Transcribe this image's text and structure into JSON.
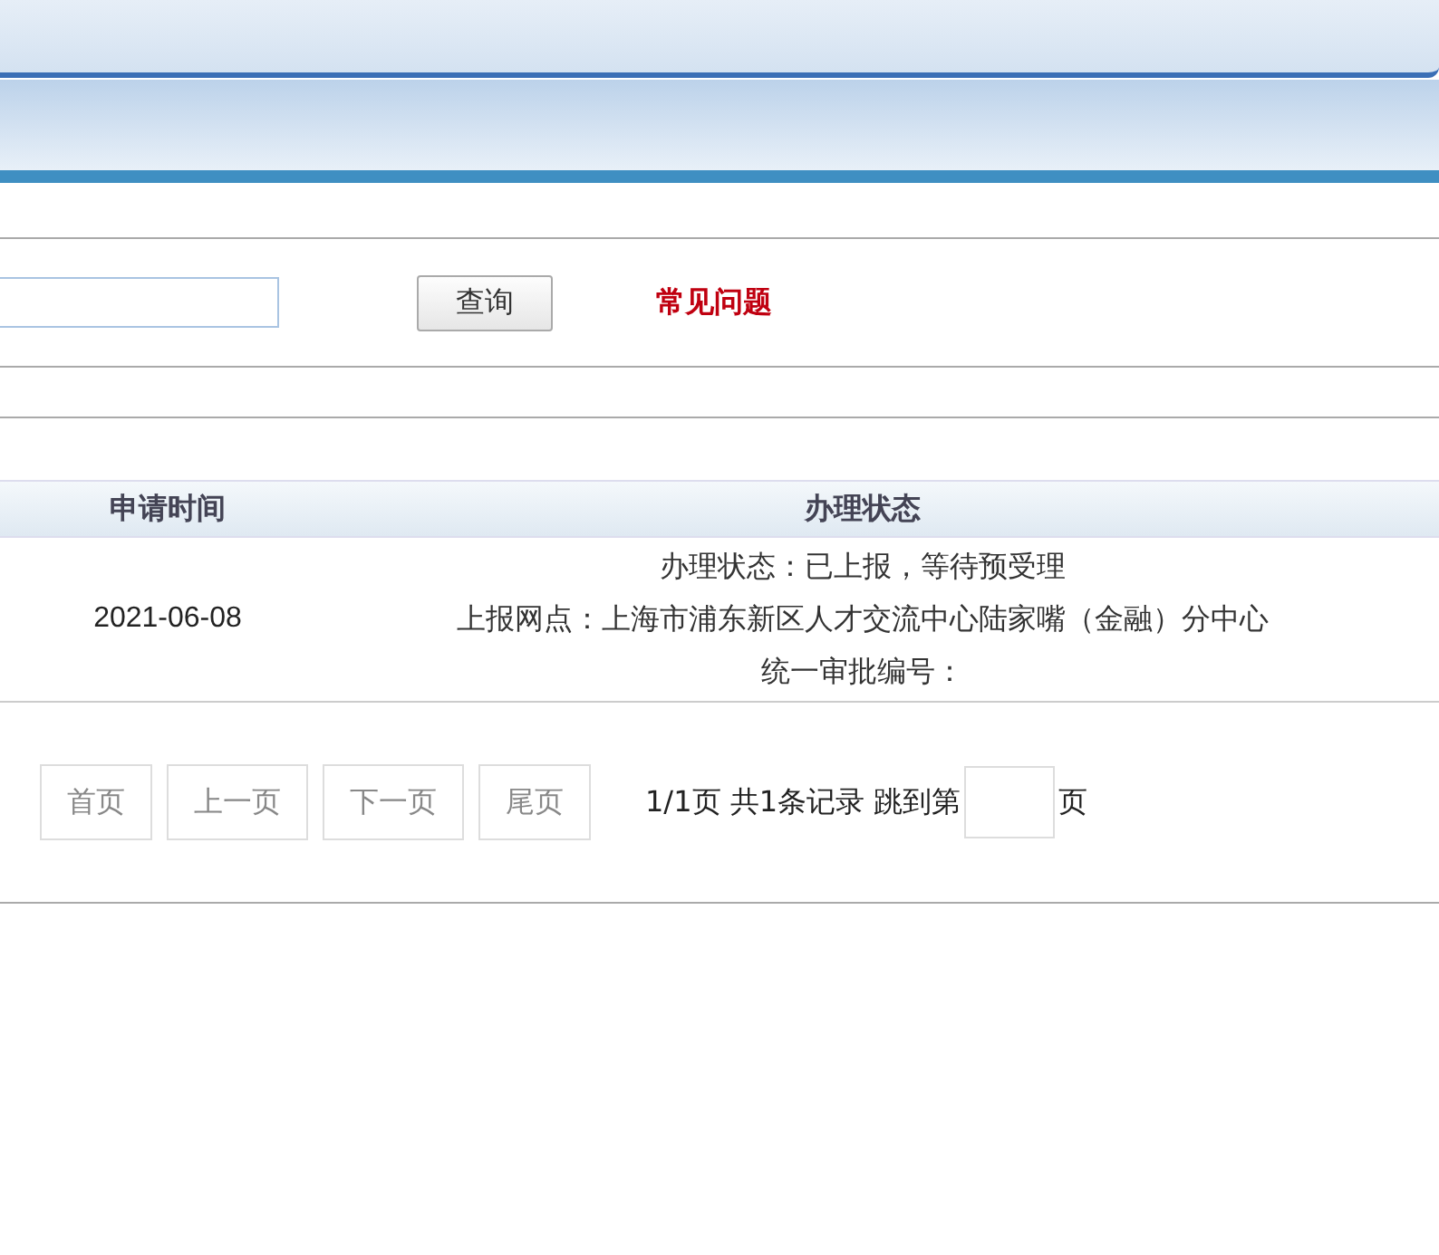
{
  "search": {
    "button": "查询",
    "link": "常见问题"
  },
  "table": {
    "columns": [
      "申请时间",
      "办理状态"
    ],
    "rows": [
      {
        "date": "2021-06-08",
        "status_lines": [
          "办理状态：已上报，等待预受理",
          "上报网点：上海市浦东新区人才交流中心陆家嘴（金融）分中心",
          "统一审批编号："
        ]
      }
    ]
  },
  "pagination": {
    "buttons": [
      {
        "label": "首页",
        "disabled": true
      },
      {
        "label": "上一页",
        "disabled": true
      },
      {
        "label": "下一页",
        "disabled": true
      },
      {
        "label": "尾页",
        "disabled": true
      }
    ],
    "summary": "1/1页 共1条记录 跳到第",
    "suffix": "页"
  }
}
